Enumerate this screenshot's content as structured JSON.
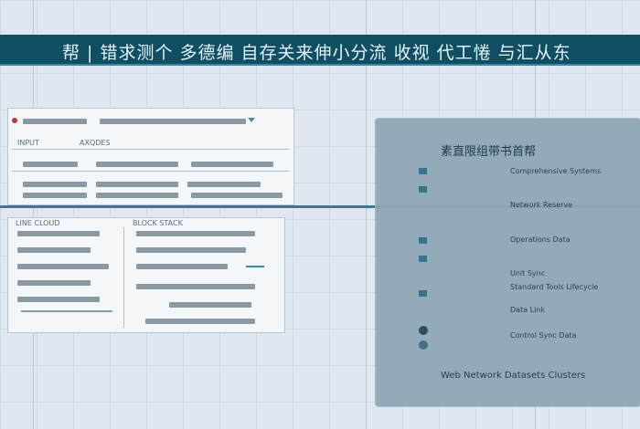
{
  "banner": {
    "title": "帮 | 错求测个 多德编 自存关来伸小分流 收视 代工惓 与汇从东"
  },
  "top_panel": {
    "label_left": "INPUT",
    "label_mid": "AXQDES"
  },
  "mid_panel": {
    "header_left": "LINE CLOUD",
    "header_mid": "BLOCK STACK"
  },
  "right_panel": {
    "title": "素直限组带书首帮",
    "rows": [
      "Comprehensive Systems",
      "Network Reserve",
      "Operations Data",
      "Unit Sync",
      "Standard Tools Lifecycle",
      "Data Link",
      "Control Sync Data"
    ],
    "footer": "Web Network Datasets Clusters"
  }
}
